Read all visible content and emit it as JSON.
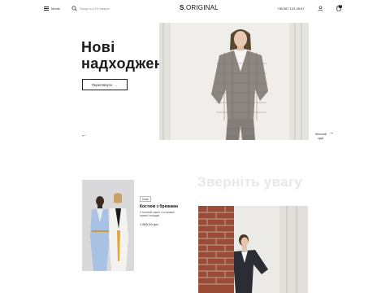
{
  "header": {
    "menu_label": "Меню",
    "search_placeholder": "Пошук по 124 товарах",
    "logo_bold": "S",
    "logo_rest": ".ORIGINAL",
    "phone": "+38 067 123 45 67",
    "cart_count": "0"
  },
  "hero": {
    "title_line1": "Нові",
    "title_line2": "надходження",
    "button_label": "Переглянути",
    "next_label_line1": "Жіночий",
    "next_label_line2": "одяг"
  },
  "section": {
    "title": "Зверніть увагу"
  },
  "product": {
    "tag": "Нове",
    "name": "Костюм з брюками",
    "description": "Стильний жакет з штанами прямої посадки",
    "price": "1 500,00 грн."
  },
  "colors": {
    "accent": "#111111",
    "section_title": "#e8e8e8"
  }
}
